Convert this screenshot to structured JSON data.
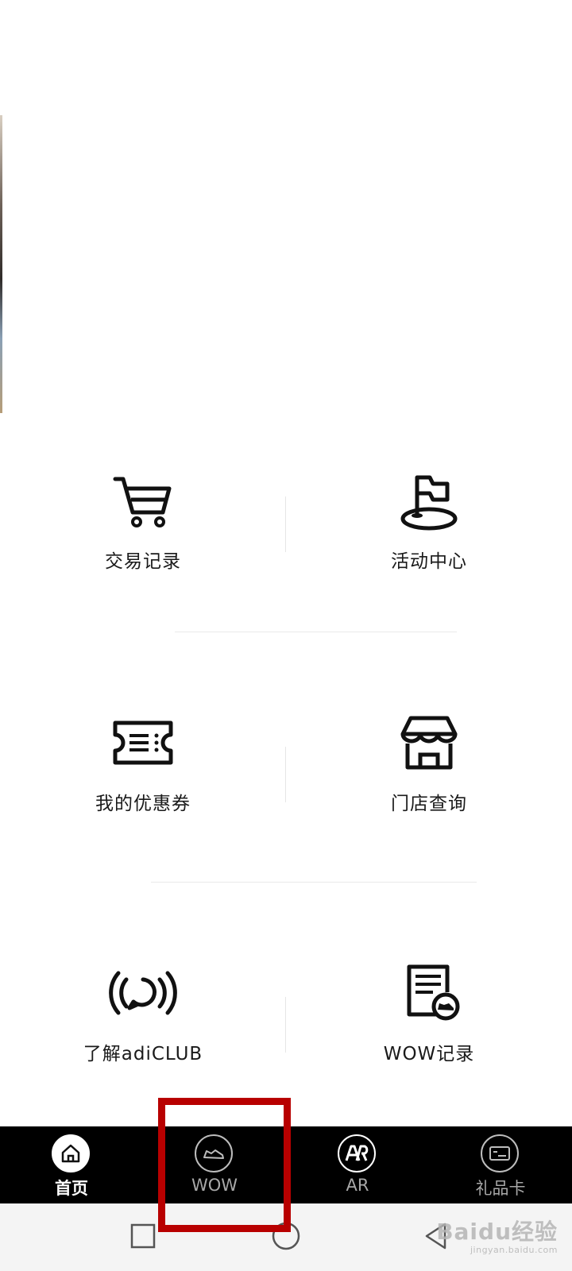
{
  "menu": {
    "items": [
      {
        "label": "交易记录",
        "icon": "shopping-cart-icon"
      },
      {
        "label": "活动中心",
        "icon": "flag-icon"
      },
      {
        "label": "我的优惠券",
        "icon": "ticket-icon"
      },
      {
        "label": "门店查询",
        "icon": "store-icon"
      },
      {
        "label": "了解adiCLUB",
        "icon": "broadcast-icon"
      },
      {
        "label": "WOW记录",
        "icon": "document-sneaker-icon"
      }
    ]
  },
  "tabbar": {
    "active_index": 0,
    "tabs": [
      {
        "label": "首页",
        "icon": "home-icon"
      },
      {
        "label": "WOW",
        "icon": "sneaker-icon"
      },
      {
        "label": "AR",
        "icon": "ar-icon"
      },
      {
        "label": "礼品卡",
        "icon": "gift-card-icon"
      }
    ]
  },
  "system_nav": {
    "buttons": [
      "recent-apps-icon",
      "home-circle-icon",
      "back-triangle-icon"
    ]
  },
  "highlight": {
    "target": "WOW",
    "color": "#b80000"
  },
  "watermark": {
    "main": "Baidu经验",
    "sub": "jingyan.baidu.com"
  },
  "colors": {
    "tabbar_bg": "#000000",
    "tab_active": "#ffffff",
    "tab_inactive": "#a8a8a8",
    "text": "#1a1a1a"
  }
}
